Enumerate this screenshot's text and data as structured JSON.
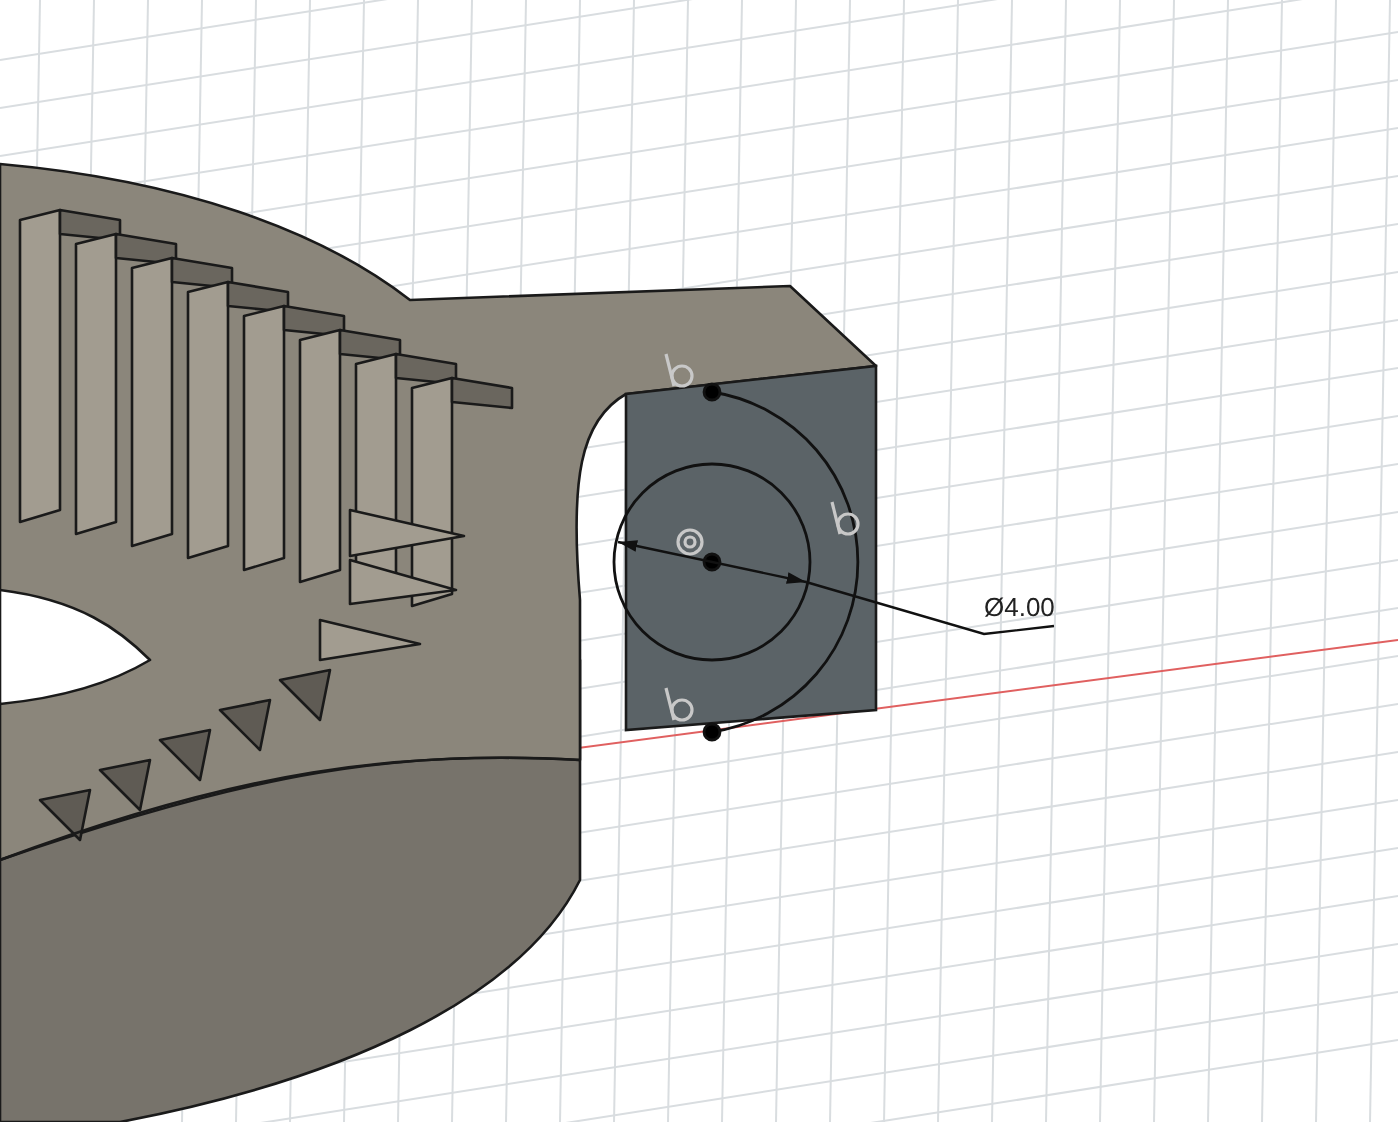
{
  "viewport": {
    "dimension": {
      "text": "Ø4.00"
    }
  }
}
